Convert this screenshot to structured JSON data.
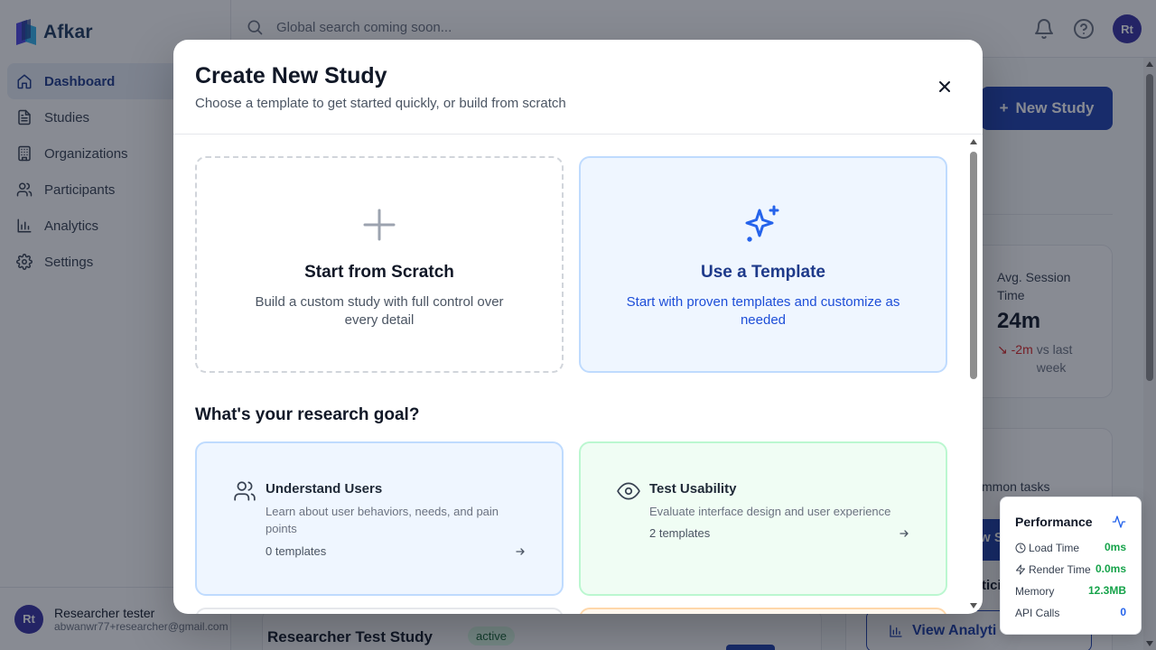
{
  "app": {
    "name": "Afkar"
  },
  "sidebar": {
    "items": [
      {
        "label": "Dashboard",
        "icon": "home-icon",
        "active": true
      },
      {
        "label": "Studies",
        "icon": "document-icon"
      },
      {
        "label": "Organizations",
        "icon": "building-icon"
      },
      {
        "label": "Participants",
        "icon": "users-icon"
      },
      {
        "label": "Analytics",
        "icon": "bar-chart-icon"
      },
      {
        "label": "Settings",
        "icon": "gear-icon"
      }
    ],
    "user": {
      "initials": "Rt",
      "name": "Researcher tester",
      "email": "abwanwr77+researcher@gmail.com"
    }
  },
  "topbar": {
    "search_placeholder": "Global search coming soon...",
    "avatar_initials": "Rt"
  },
  "background": {
    "new_study_label": "New Study",
    "stat": {
      "label": "Avg. Session Time",
      "value": "24m",
      "delta": "-2m",
      "delta_suffix": "vs last week"
    },
    "quick_actions_desc": "mmon tasks",
    "quick_btn_partial": "w S",
    "quick_text_partial": "tici",
    "view_analytics": "View Analyti",
    "study": {
      "name": "Researcher Test Study",
      "status": "active"
    }
  },
  "modal": {
    "title": "Create New Study",
    "subtitle": "Choose a template to get started quickly, or build from scratch",
    "options": [
      {
        "title": "Start from Scratch",
        "desc": "Build a custom study with full control over every detail",
        "icon": "plus-icon"
      },
      {
        "title": "Use a Template",
        "desc": "Start with proven templates and customize as needed",
        "icon": "sparkles-icon"
      }
    ],
    "goal_heading": "What's your research goal?",
    "goals": [
      {
        "title": "Understand Users",
        "desc": "Learn about user behaviors, needs, and pain points",
        "count": "0 templates",
        "icon": "users-icon"
      },
      {
        "title": "Test Usability",
        "desc": "Evaluate interface design and user experience",
        "count": "2 templates",
        "icon": "eye-icon"
      }
    ]
  },
  "performance": {
    "title": "Performance",
    "rows": [
      {
        "label": "Load Time",
        "value": "0ms"
      },
      {
        "label": "Render Time",
        "value": "0.0ms"
      },
      {
        "label": "Memory",
        "value": "12.3MB"
      },
      {
        "label": "API Calls",
        "value": "0"
      }
    ]
  },
  "colors": {
    "primary": "#1e40af",
    "avatar": "#3730a3",
    "success": "#16a34a",
    "danger": "#dc2626"
  }
}
